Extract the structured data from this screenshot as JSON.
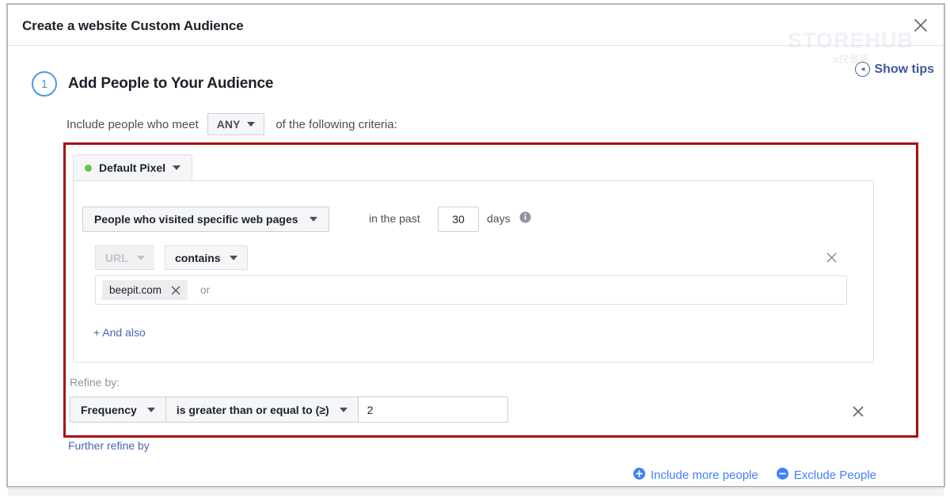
{
  "dialog": {
    "title": "Create a website Custom Audience",
    "close_icon": "close-icon",
    "watermark": "STOREHUB",
    "watermark_sub": "a快餐店"
  },
  "show_tips": {
    "label": "Show tips",
    "icon": "chevron-left-circle-icon"
  },
  "step": {
    "number": "1",
    "title": "Add People to Your Audience"
  },
  "include": {
    "prefix": "Include people who meet",
    "match_value": "ANY",
    "suffix": "of the following criteria:"
  },
  "pixel": {
    "label": "Default Pixel",
    "status_color": "#6cc24a"
  },
  "rule": {
    "type_label": "People who visited specific web pages",
    "past_prefix": "in the past",
    "days_value": "30",
    "days_suffix": "days",
    "info_icon": "info-icon",
    "field_label": "URL",
    "operator_label": "contains",
    "remove_icon": "close-icon",
    "tokens": [
      {
        "text": "beepit.com",
        "remove_icon": "close-icon"
      }
    ],
    "or_label": "or",
    "and_also_label": "+ And also"
  },
  "refine": {
    "label": "Refine by:",
    "metric": "Frequency",
    "operator": "is greater than or equal to (≥)",
    "value": "2",
    "remove_icon": "close-icon",
    "further_label": "Further refine by"
  },
  "actions": [
    {
      "label": "Include more people",
      "icon": "plus-circle-icon"
    },
    {
      "label": "Exclude People",
      "icon": "minus-circle-icon"
    }
  ],
  "colors": {
    "accent_blue": "#4080ff",
    "link_blue": "#4267b2",
    "highlight_red": "#a81010",
    "pixel_green": "#6cc24a"
  }
}
